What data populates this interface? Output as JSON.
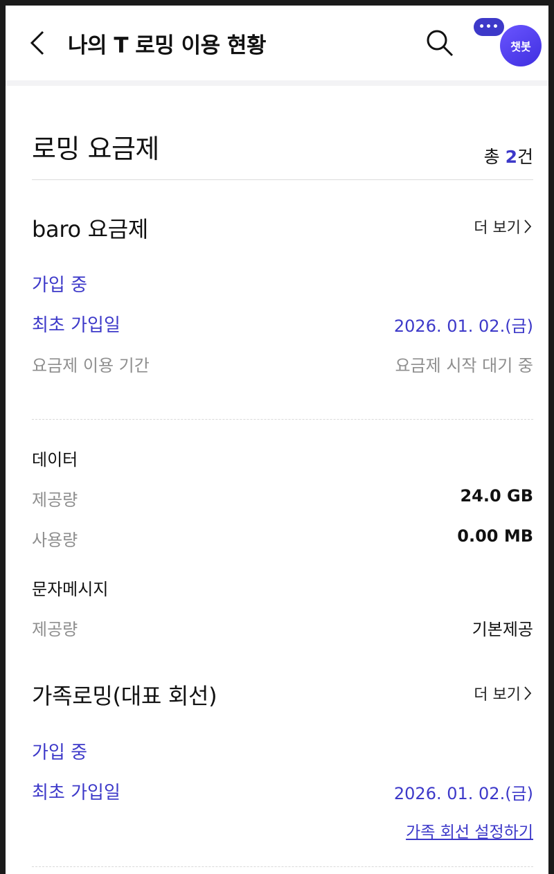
{
  "header": {
    "title": "나의 T 로밍 이용 현황",
    "chatbot_label": "챗봇",
    "chatbot_dots": "•••"
  },
  "section": {
    "title": "로밍 요금제",
    "total_prefix": "총 ",
    "total_count": "2",
    "total_suffix": "건"
  },
  "plans": [
    {
      "name": "baro 요금제",
      "more_label": "더 보기",
      "status": "가입 중",
      "first_join_label": "최초 가입일",
      "first_join_value": "2026. 01. 02.(금)",
      "period_label": "요금제 이용 기간",
      "period_value": "요금제 시작 대기 중",
      "data_heading": "데이터",
      "data_provided_label": "제공량",
      "data_provided_value": "24.0 GB",
      "data_used_label": "사용량",
      "data_used_value": "0.00 MB",
      "sms_heading": "문자메시지",
      "sms_provided_label": "제공량",
      "sms_provided_value": "기본제공"
    },
    {
      "name": "가족로밍(대표 회선)",
      "more_label": "더 보기",
      "status": "가입 중",
      "first_join_label": "최초 가입일",
      "first_join_value": "2026. 01. 02.(금)",
      "family_link": "가족 회선 설정하기"
    }
  ],
  "icons": [
    "back-arrow-icon",
    "search-icon",
    "chevron-right-icon",
    "chat-dots-icon"
  ],
  "colors": {
    "accent": "#3d39c9",
    "muted": "#8e8e8e",
    "text": "#111111"
  }
}
